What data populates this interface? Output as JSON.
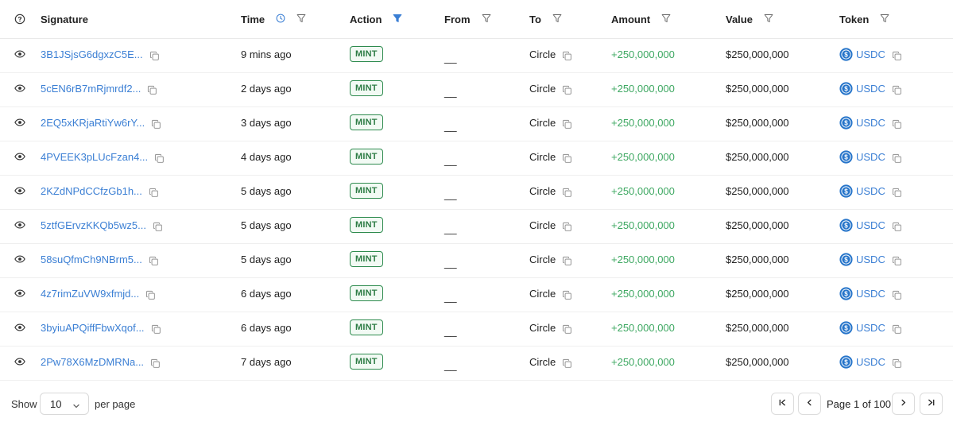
{
  "header": {
    "columns": {
      "signature": "Signature",
      "time": "Time",
      "action": "Action",
      "from": "From",
      "to": "To",
      "amount": "Amount",
      "value": "Value",
      "token": "Token"
    },
    "icons": {
      "help": "question-circle-icon",
      "time_clock": "clock-icon",
      "filter": "filter-icon",
      "active_filter_color": "#3b7fd4"
    }
  },
  "rows": [
    {
      "signature": "3B1JSjsG6dgxzC5E...",
      "time": "9 mins ago",
      "action": "MINT",
      "from": "__",
      "to": "Circle",
      "amount": "+250,000,000",
      "value": "$250,000,000",
      "token": "USDC"
    },
    {
      "signature": "5cEN6rB7mRjmrdf2...",
      "time": "2 days ago",
      "action": "MINT",
      "from": "__",
      "to": "Circle",
      "amount": "+250,000,000",
      "value": "$250,000,000",
      "token": "USDC"
    },
    {
      "signature": "2EQ5xKRjaRtiYw6rY...",
      "time": "3 days ago",
      "action": "MINT",
      "from": "__",
      "to": "Circle",
      "amount": "+250,000,000",
      "value": "$250,000,000",
      "token": "USDC"
    },
    {
      "signature": "4PVEEK3pLUcFzan4...",
      "time": "4 days ago",
      "action": "MINT",
      "from": "__",
      "to": "Circle",
      "amount": "+250,000,000",
      "value": "$250,000,000",
      "token": "USDC"
    },
    {
      "signature": "2KZdNPdCCfzGb1h...",
      "time": "5 days ago",
      "action": "MINT",
      "from": "__",
      "to": "Circle",
      "amount": "+250,000,000",
      "value": "$250,000,000",
      "token": "USDC"
    },
    {
      "signature": "5ztfGErvzKKQb5wz5...",
      "time": "5 days ago",
      "action": "MINT",
      "from": "__",
      "to": "Circle",
      "amount": "+250,000,000",
      "value": "$250,000,000",
      "token": "USDC"
    },
    {
      "signature": "58suQfmCh9NBrm5...",
      "time": "5 days ago",
      "action": "MINT",
      "from": "__",
      "to": "Circle",
      "amount": "+250,000,000",
      "value": "$250,000,000",
      "token": "USDC"
    },
    {
      "signature": "4z7rimZuVW9xfmjd...",
      "time": "6 days ago",
      "action": "MINT",
      "from": "__",
      "to": "Circle",
      "amount": "+250,000,000",
      "value": "$250,000,000",
      "token": "USDC"
    },
    {
      "signature": "3byiuAPQiffFbwXqof...",
      "time": "6 days ago",
      "action": "MINT",
      "from": "__",
      "to": "Circle",
      "amount": "+250,000,000",
      "value": "$250,000,000",
      "token": "USDC"
    },
    {
      "signature": "2Pw78X6MzDMRNa...",
      "time": "7 days ago",
      "action": "MINT",
      "from": "__",
      "to": "Circle",
      "amount": "+250,000,000",
      "value": "$250,000,000",
      "token": "USDC"
    }
  ],
  "footer": {
    "show_label": "Show",
    "per_page_value": "10",
    "per_page_label": "per page",
    "page_info": "Page 1 of 100"
  },
  "colors": {
    "link": "#3b7fd4",
    "amount_positive": "#3ea862",
    "badge_border": "#2e8b4e",
    "usdc": "#2775ca"
  }
}
